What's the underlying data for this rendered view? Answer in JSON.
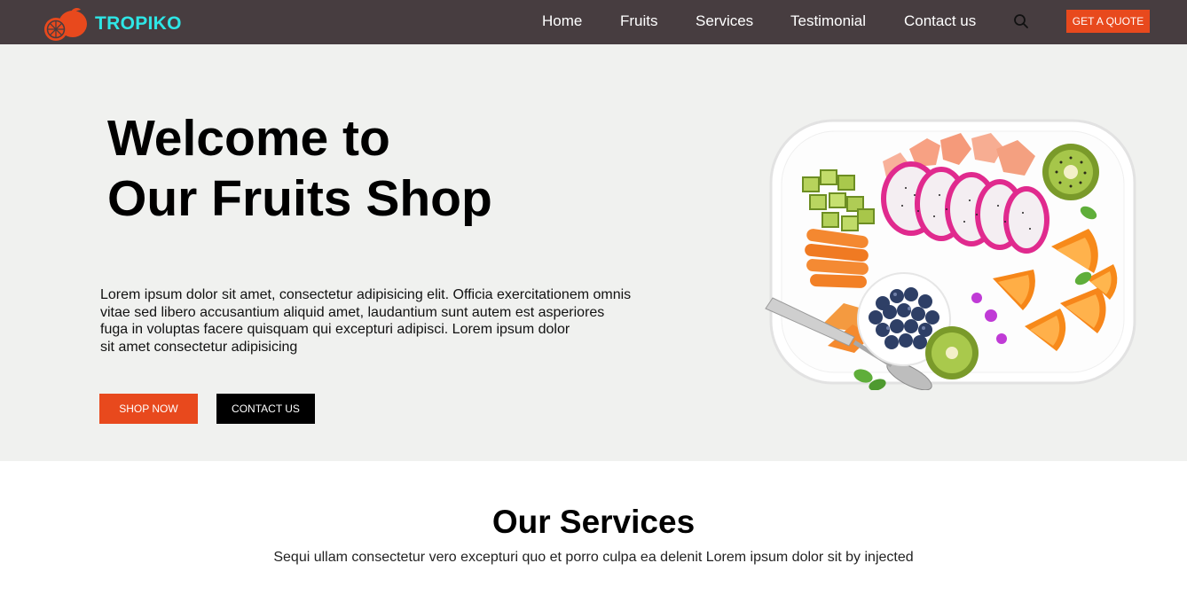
{
  "brand": {
    "name": "TROPIKO"
  },
  "nav": {
    "items": [
      {
        "label": "Home"
      },
      {
        "label": "Fruits"
      },
      {
        "label": "Services"
      },
      {
        "label": "Testimonial"
      },
      {
        "label": "Contact us"
      }
    ],
    "search_icon": "search-icon",
    "quote_label": "GET A QUOTE"
  },
  "hero": {
    "title_lines": [
      "Welcome to",
      "Our Fruits Shop"
    ],
    "description_lines": [
      "Lorem ipsum dolor sit amet, consectetur adipisicing elit. Officia exercitationem omnis",
      "vitae sed libero accusantium aliquid amet, laudantium sunt autem est asperiores",
      "fuga in voluptas facere quisquam qui excepturi adipisci. Lorem ipsum dolor",
      "sit amet consectetur adipisicing"
    ],
    "shop_label": "SHOP NOW",
    "contact_label": "CONTACT US",
    "image": "fruit-plate-image"
  },
  "services": {
    "title": "Our Services",
    "subtitle": "Sequi ullam consectetur vero excepturi quo et porro culpa ea delenit Lorem ipsum dolor sit by injected"
  },
  "colors": {
    "nav_bg": "#473d40",
    "brand_text": "#2ee6e6",
    "accent": "#e8491d",
    "hero_bg": "#f0f1ef"
  }
}
